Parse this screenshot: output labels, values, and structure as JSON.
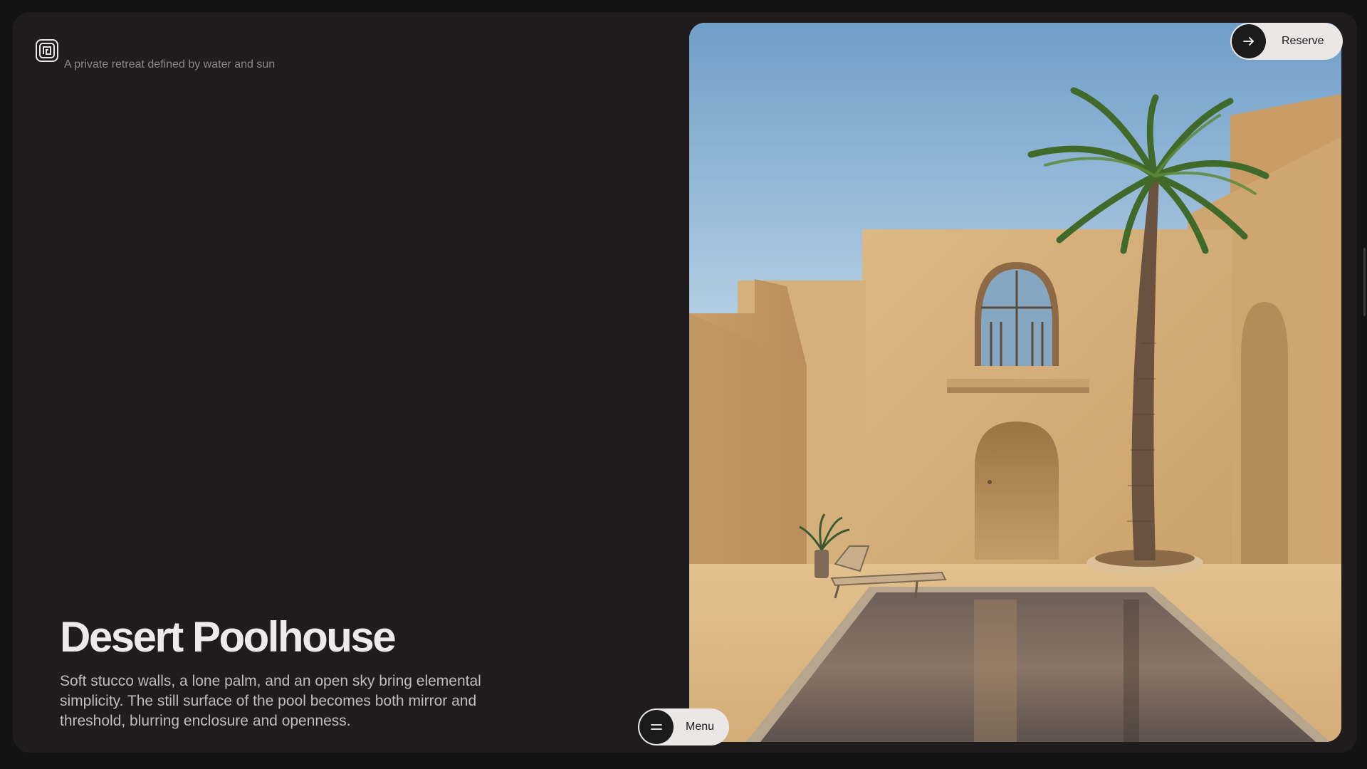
{
  "brand": {
    "logo_icon": "spiral-square-logo"
  },
  "header": {
    "tagline": "A private retreat defined by water and sun"
  },
  "content": {
    "title": "Desert Poolhouse",
    "description": "Soft stucco walls, a lone palm, and an open sky bring elemental simplicity. The still surface of the pool becomes both mirror and threshold, blurring enclosure and openness."
  },
  "actions": {
    "reserve_label": "Reserve",
    "reserve_icon": "arrow-right-icon",
    "menu_label": "Menu",
    "menu_icon": "menu-lines-icon"
  },
  "colors": {
    "page_background": "#131314",
    "panel_background": "#1e1c1d",
    "pill_background": "#eae7e6",
    "pill_circle": "#1c1b1c",
    "stucco": "#d2ac74",
    "sky": "#a9c6dd"
  }
}
